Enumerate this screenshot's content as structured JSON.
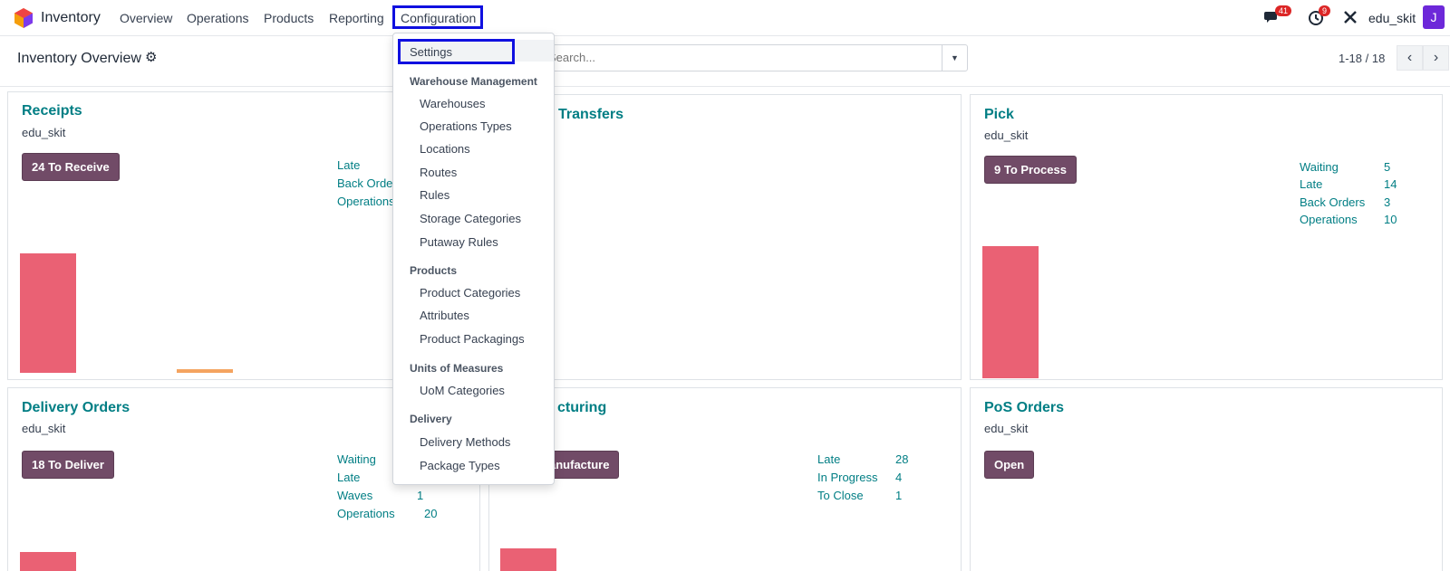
{
  "navbar": {
    "app_name": "Inventory",
    "menu": [
      "Overview",
      "Operations",
      "Products",
      "Reporting",
      "Configuration"
    ],
    "chat_badge": "41",
    "activity_badge": "9",
    "username": "edu_skit",
    "avatar_letter": "J"
  },
  "control_panel": {
    "title": "Inventory Overview",
    "search_placeholder": "Search...",
    "pager": "1-18 / 18"
  },
  "dropdown": {
    "settings": "Settings",
    "groups": [
      {
        "header": "Warehouse Management",
        "items": [
          "Warehouses",
          "Operations Types",
          "Locations",
          "Routes",
          "Rules",
          "Storage Categories",
          "Putaway Rules"
        ]
      },
      {
        "header": "Products",
        "items": [
          "Product Categories",
          "Attributes",
          "Product Packagings"
        ]
      },
      {
        "header": "Units of Measures",
        "items": [
          "UoM Categories"
        ]
      },
      {
        "header": "Delivery",
        "items": [
          "Delivery Methods",
          "Package Types"
        ]
      }
    ]
  },
  "cards": {
    "receipts": {
      "title": "Receipts",
      "company": "edu_skit",
      "button": "24 To Receive",
      "stats": [
        {
          "label": "Late",
          "value": ""
        },
        {
          "label": "Back Orde",
          "value": ""
        },
        {
          "label": "Operations",
          "value": ""
        }
      ]
    },
    "internal": {
      "title": "Transfers"
    },
    "pick": {
      "title": "Pick",
      "company": "edu_skit",
      "button": "9 To Process",
      "stats": [
        {
          "label": "Waiting",
          "value": "5"
        },
        {
          "label": "Late",
          "value": "14"
        },
        {
          "label": "Back Orders",
          "value": "3"
        },
        {
          "label": "Operations",
          "value": "10"
        }
      ]
    },
    "delivery": {
      "title": "Delivery Orders",
      "company": "edu_skit",
      "button": "18 To Deliver",
      "stats": [
        {
          "label": "Waiting",
          "value": ""
        },
        {
          "label": "Late",
          "value": ""
        },
        {
          "label": "Waves",
          "value": "1"
        },
        {
          "label": "Operations",
          "value": "20"
        }
      ]
    },
    "manufacturing": {
      "title": "cturing",
      "button": "anufacture",
      "stats": [
        {
          "label": "Late",
          "value": "28"
        },
        {
          "label": "In Progress",
          "value": "4"
        },
        {
          "label": "To Close",
          "value": "1"
        }
      ]
    },
    "pos": {
      "title": "PoS Orders",
      "company": "edu_skit",
      "button": "Open"
    }
  },
  "colors": {
    "accent": "#017e84",
    "button": "#714b67",
    "bar_red": "#ea6174",
    "bar_orange": "#f4a460",
    "highlight_frame": "#1010e0"
  }
}
